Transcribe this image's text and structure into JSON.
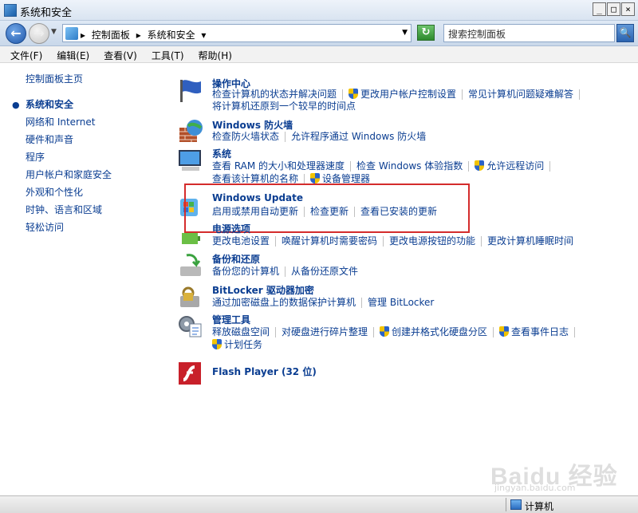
{
  "window": {
    "title": "系统和安全",
    "controls": [
      "_",
      "□",
      "×"
    ]
  },
  "address": {
    "crumbs": [
      "控制面板",
      "系统和安全"
    ],
    "search_placeholder": "搜索控制面板"
  },
  "menu": [
    "文件(F)",
    "编辑(E)",
    "查看(V)",
    "工具(T)",
    "帮助(H)"
  ],
  "sidebar": {
    "home": "控制面板主页",
    "items": [
      {
        "label": "系统和安全",
        "current": true
      },
      {
        "label": "网络和 Internet"
      },
      {
        "label": "硬件和声音"
      },
      {
        "label": "程序"
      },
      {
        "label": "用户帐户和家庭安全"
      },
      {
        "label": "外观和个性化"
      },
      {
        "label": "时钟、语言和区域"
      },
      {
        "label": "轻松访问"
      }
    ]
  },
  "categories": {
    "action_center": {
      "title": "操作中心",
      "line1": {
        "a": "检查计算机的状态并解决问题",
        "b": "更改用户帐户控制设置",
        "c": "常见计算机问题疑难解答"
      },
      "line2": {
        "a": "将计算机还原到一个较早的时间点"
      }
    },
    "firewall": {
      "title": "Windows 防火墙",
      "line1": {
        "a": "检查防火墙状态",
        "b": "允许程序通过 Windows 防火墙"
      }
    },
    "system": {
      "title": "系统",
      "line1": {
        "a": "查看 RAM 的大小和处理器速度",
        "b": "检查 Windows 体验指数",
        "c": "允许远程访问"
      },
      "line2": {
        "a": "查看该计算机的名称",
        "b": "设备管理器"
      }
    },
    "windows_update": {
      "title": "Windows Update",
      "line1": {
        "a": "启用或禁用自动更新",
        "b": "检查更新",
        "c": "查看已安装的更新"
      }
    },
    "power": {
      "title": "电源选项",
      "line1": {
        "a": "更改电池设置",
        "b": "唤醒计算机时需要密码",
        "c": "更改电源按钮的功能",
        "d": "更改计算机睡眠时间"
      }
    },
    "backup": {
      "title": "备份和还原",
      "line1": {
        "a": "备份您的计算机",
        "b": "从备份还原文件"
      }
    },
    "bitlocker": {
      "title": "BitLocker 驱动器加密",
      "line1": {
        "a": "通过加密磁盘上的数据保护计算机",
        "b": "管理 BitLocker"
      }
    },
    "admin_tools": {
      "title": "管理工具",
      "line1": {
        "a": "释放磁盘空间",
        "b": "对硬盘进行碎片整理",
        "c": "创建并格式化硬盘分区",
        "d": "查看事件日志"
      },
      "line2": {
        "a": "计划任务"
      }
    },
    "flash": {
      "title": "Flash Player (32 位)"
    }
  },
  "status": {
    "text": "计算机"
  },
  "watermark": {
    "main": "Baidu 经验",
    "sub": "jingyan.baidu.com"
  }
}
